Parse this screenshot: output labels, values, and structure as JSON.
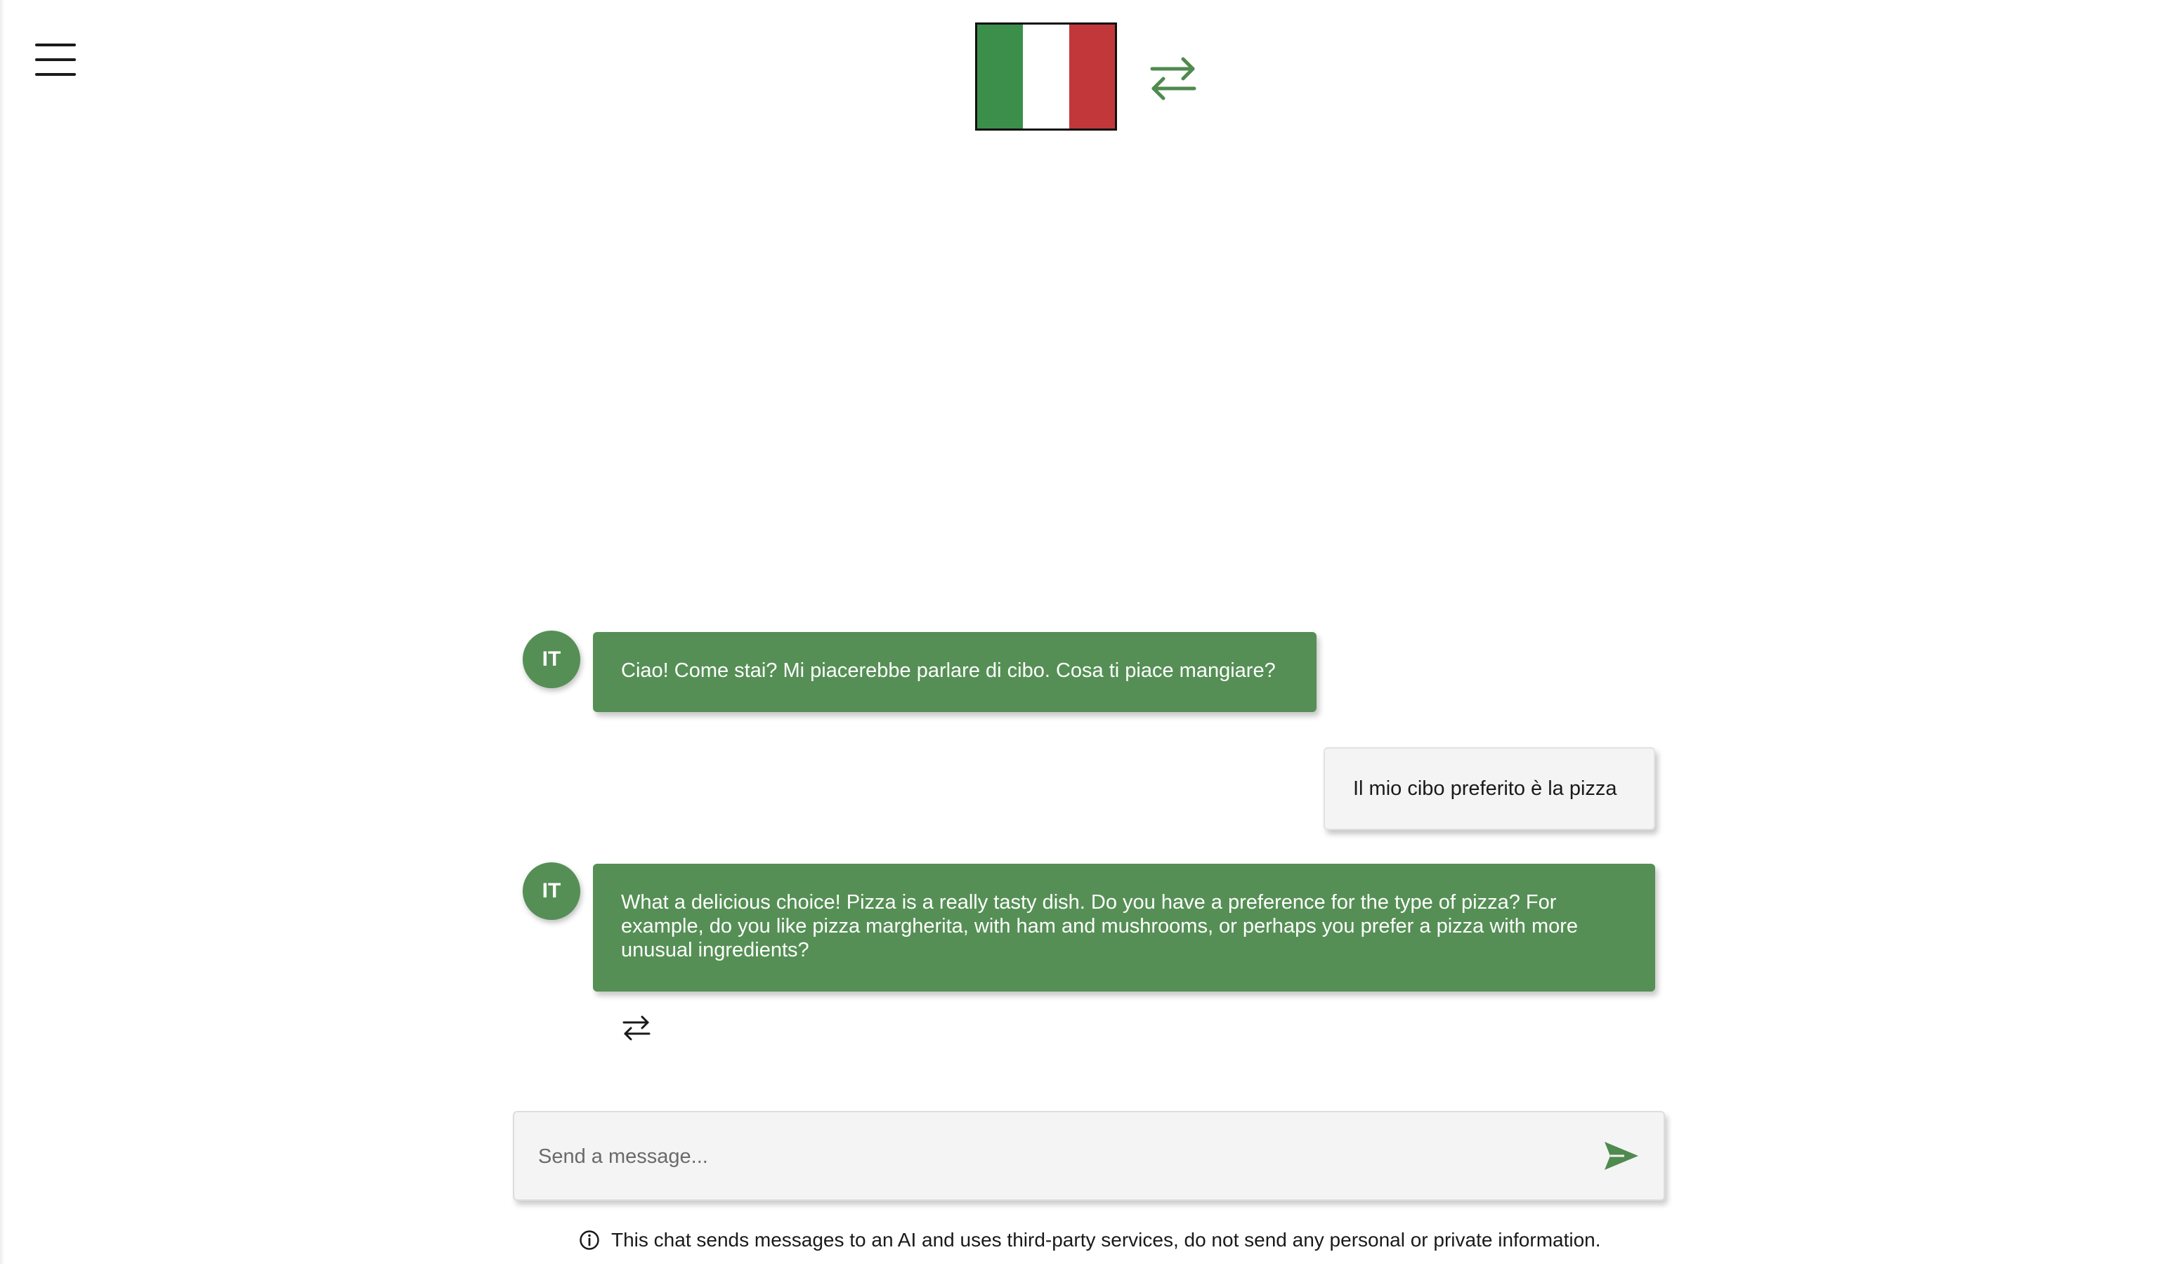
{
  "header": {
    "menu_icon": "hamburger-menu-icon",
    "flag": {
      "country": "Italy",
      "colors": [
        "#3b8f4a",
        "#ffffff",
        "#c2373a"
      ]
    },
    "swap_icon": "swap-arrows-icon"
  },
  "colors": {
    "accent_green": "#558f55",
    "ai_bubble": "#558f55",
    "user_bubble": "#f4f4f4"
  },
  "messages": [
    {
      "role": "ai",
      "avatar_label": "IT",
      "text": "Ciao! Come stai? Mi piacerebbe parlare di cibo. Cosa ti piace mangiare?"
    },
    {
      "role": "user",
      "text": "Il mio cibo preferito è la pizza"
    },
    {
      "role": "ai",
      "avatar_label": "IT",
      "text": "What a delicious choice! Pizza is a really tasty dish. Do you have a preference for the type of pizza? For example, do you like pizza margherita, with ham and mushrooms, or perhaps you prefer a pizza with more unusual ingredients?"
    }
  ],
  "message_actions": {
    "translate_icon": "swap-arrows-icon"
  },
  "composer": {
    "placeholder": "Send a message...",
    "value": "",
    "send_icon": "send-arrow-icon"
  },
  "disclaimer": {
    "icon": "info-icon",
    "text": "This chat sends messages to an AI and uses third-party services, do not send any personal or private information."
  }
}
